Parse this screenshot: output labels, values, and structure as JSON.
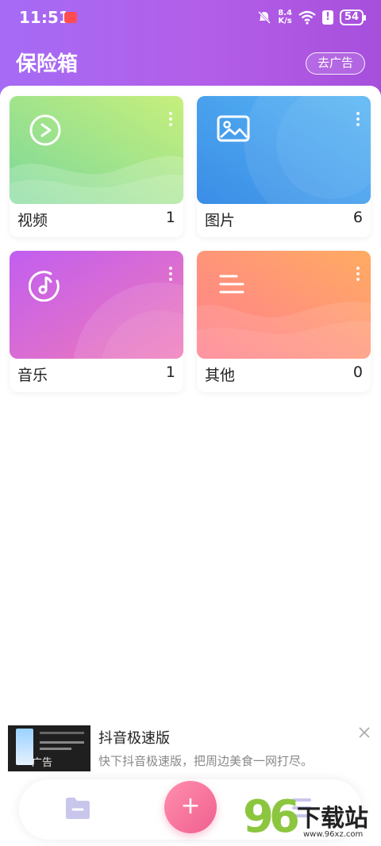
{
  "status_bar": {
    "time": "11:51",
    "net_speed_value": "8.4",
    "net_speed_unit": "K/s",
    "battery": "54"
  },
  "header": {
    "title": "保险箱",
    "ad_button": "去广告"
  },
  "categories": [
    {
      "label": "视频",
      "count": "1",
      "icon": "play-icon",
      "colors": [
        "#7cd89a",
        "#c7ef7c"
      ]
    },
    {
      "label": "图片",
      "count": "6",
      "icon": "image-icon",
      "colors": [
        "#3b8de6",
        "#58b6f5"
      ]
    },
    {
      "label": "音乐",
      "count": "1",
      "icon": "music-note-icon",
      "colors": [
        "#c15ef0",
        "#f07ab8"
      ]
    },
    {
      "label": "其他",
      "count": "0",
      "icon": "menu-lines-icon",
      "colors": [
        "#ff7f8f",
        "#ffab62"
      ]
    }
  ],
  "ad": {
    "title": "抖音极速版",
    "subtitle": "快下抖音极速版，把周边美食一网打尽。",
    "tag": "广告"
  },
  "bottom_nav": {
    "add_symbol": "+"
  },
  "watermark": {
    "number": "96",
    "text": "下载站",
    "url": "www.96xz.com"
  }
}
